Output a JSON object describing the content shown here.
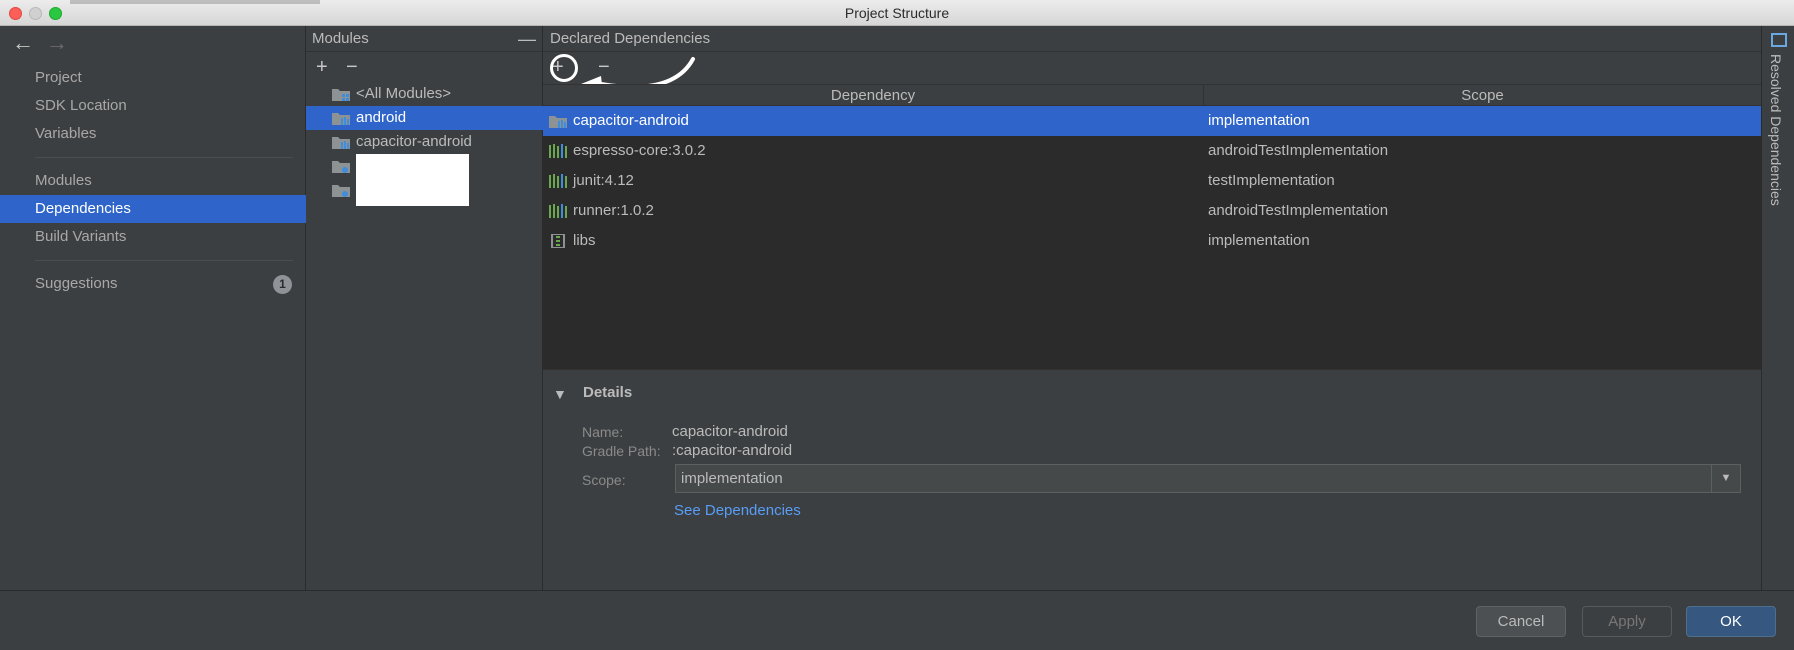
{
  "window": {
    "title": "Project Structure"
  },
  "sidebar": {
    "items": [
      {
        "label": "Project",
        "selected": false
      },
      {
        "label": "SDK Location",
        "selected": false
      },
      {
        "label": "Variables",
        "selected": false
      },
      {
        "label": "Modules",
        "selected": false
      },
      {
        "label": "Dependencies",
        "selected": true
      },
      {
        "label": "Build Variants",
        "selected": false
      },
      {
        "label": "Suggestions",
        "selected": false,
        "badge": "1"
      }
    ]
  },
  "modules": {
    "header": "Modules",
    "add_label": "+",
    "remove_label": "−",
    "items": [
      {
        "label": "<All Modules>",
        "selected": false
      },
      {
        "label": "android",
        "selected": true
      },
      {
        "label": "capacitor-android",
        "selected": false
      }
    ]
  },
  "main": {
    "header": "Declared Dependencies",
    "add_label": "+",
    "remove_label": "−",
    "columns": {
      "dependency": "Dependency",
      "scope": "Scope"
    },
    "rows": [
      {
        "name": "capacitor-android",
        "scope": "implementation",
        "icon": "module-icon",
        "selected": true
      },
      {
        "name": "espresso-core:3.0.2",
        "scope": "androidTestImplementation",
        "icon": "library-icon",
        "selected": false
      },
      {
        "name": "junit:4.12",
        "scope": "testImplementation",
        "icon": "library-icon",
        "selected": false
      },
      {
        "name": "runner:1.0.2",
        "scope": "androidTestImplementation",
        "icon": "library-icon",
        "selected": false
      },
      {
        "name": "libs",
        "scope": "implementation",
        "icon": "jar-icon",
        "selected": false
      }
    ],
    "details": {
      "title": "Details",
      "name_label": "Name:",
      "name_value": "capacitor-android",
      "gradle_label": "Gradle Path:",
      "gradle_value": ":capacitor-android",
      "scope_label": "Scope:",
      "scope_value": "implementation",
      "see_link": "See Dependencies"
    }
  },
  "right_strip": {
    "label": "Resolved Dependencies"
  },
  "buttons": {
    "cancel": "Cancel",
    "apply": "Apply",
    "ok": "OK"
  },
  "colors": {
    "selection": "#2f65ca",
    "link": "#589df6",
    "panel": "#3c3f41"
  }
}
